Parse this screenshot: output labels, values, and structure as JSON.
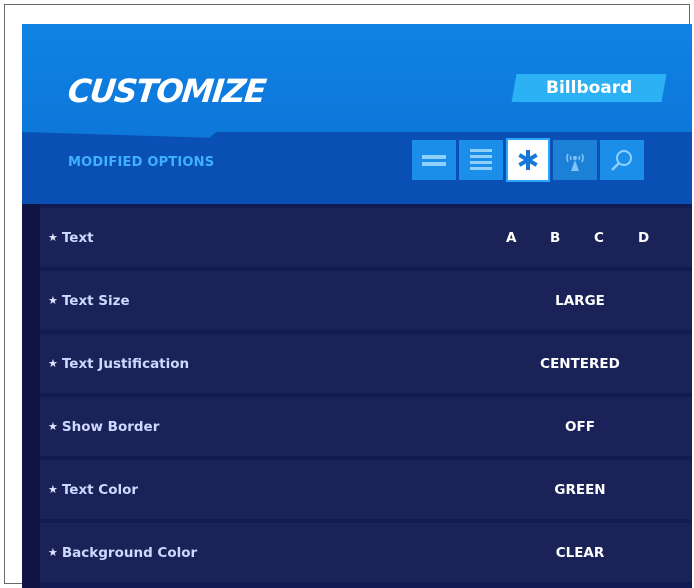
{
  "header": {
    "title": "CUSTOMIZE",
    "tag": "Billboard",
    "subtitle": "MODIFIED OPTIONS"
  },
  "tabs": [
    {
      "icon": "two-lines-icon",
      "active": false
    },
    {
      "icon": "list-lines-icon",
      "active": false
    },
    {
      "icon": "star-icon",
      "active": true
    },
    {
      "icon": "antenna-icon",
      "active": false
    },
    {
      "icon": "search-icon",
      "active": false
    }
  ],
  "options": [
    {
      "label": "Text",
      "value": "",
      "letters": [
        "A",
        "B",
        "C",
        "D"
      ]
    },
    {
      "label": "Text Size",
      "value": "LARGE"
    },
    {
      "label": "Text Justification",
      "value": "CENTERED"
    },
    {
      "label": "Show Border",
      "value": "OFF"
    },
    {
      "label": "Text Color",
      "value": "GREEN"
    },
    {
      "label": "Background Color",
      "value": "CLEAR"
    }
  ],
  "colors": {
    "header": "#0f83e4",
    "band": "#0a4fb4",
    "tag": "#2cb1f5",
    "subtitle": "#3fb2ff",
    "panel": "#141b52",
    "row": "#1b2258"
  }
}
